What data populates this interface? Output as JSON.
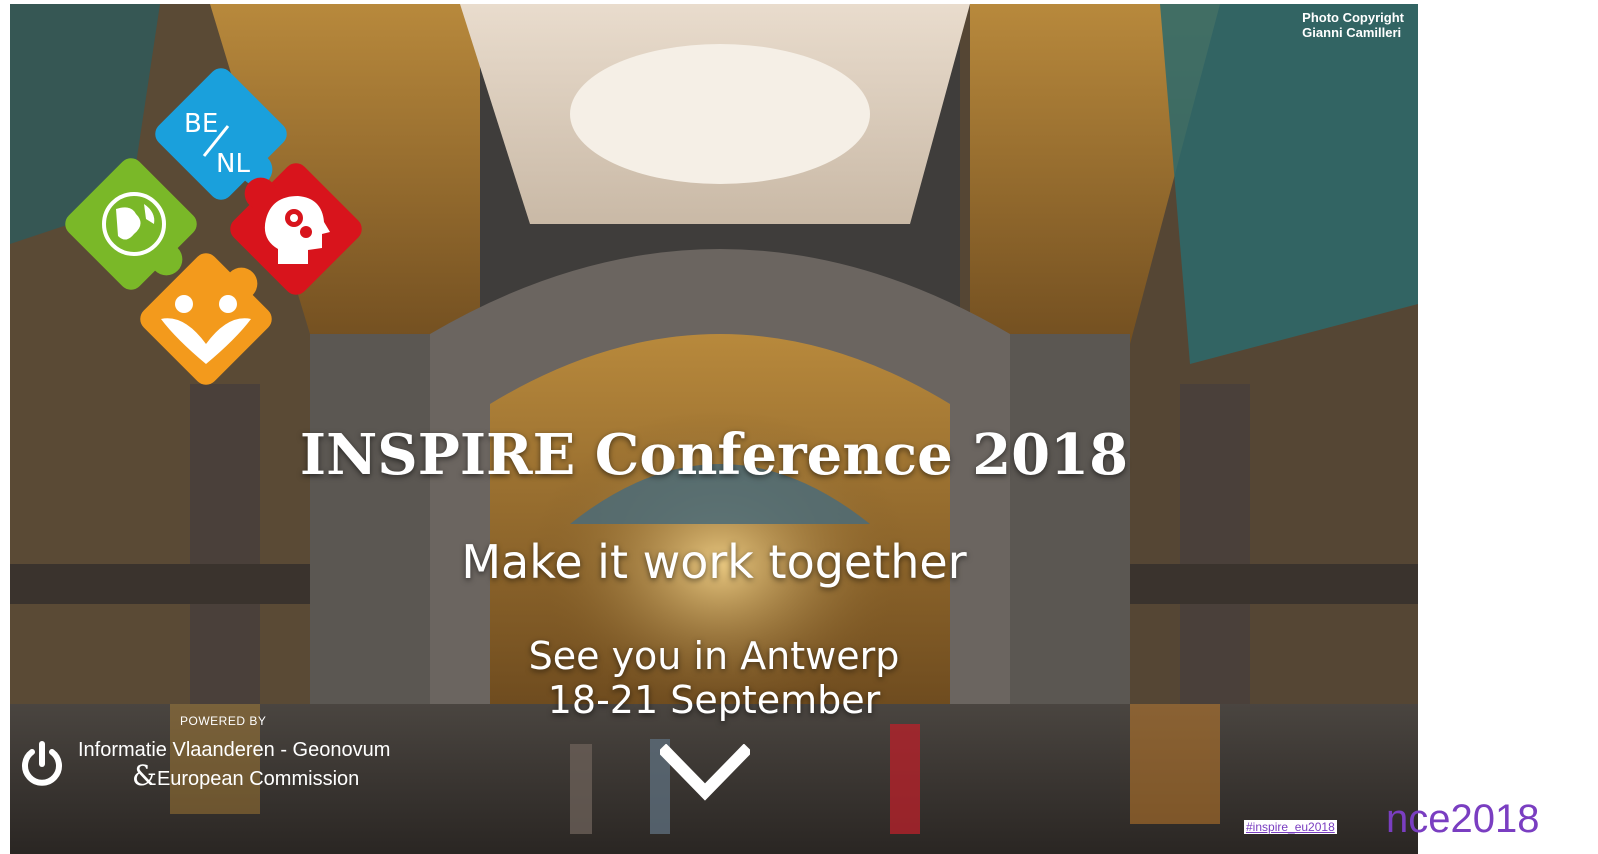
{
  "hero": {
    "copyright_line1": "Photo Copyright",
    "copyright_line2": "Gianni Camilleri",
    "logo_text_top": "BE",
    "logo_text_bottom": "NL",
    "title": "INSPIRE Conference 2018",
    "subtitle": "Make it work together",
    "venue_line1": "See you in Antwerp",
    "venue_line2": "18-21 September",
    "scroll_icon": "chevron-down-icon"
  },
  "powered_by": {
    "label": "POWERED BY",
    "line1": "Informatie Vlaanderen - Geonovum",
    "amp": "&",
    "line2": "European Commission",
    "icon": "power-icon"
  },
  "footer": {
    "hashtag": "#inspire_eu2018",
    "side_link": "nce2018"
  },
  "colors": {
    "logo_blue": "#1aa0dc",
    "logo_green": "#7ab828",
    "logo_red": "#d8141c",
    "logo_orange": "#f39a1c",
    "link_purple": "#7a3ec1"
  }
}
